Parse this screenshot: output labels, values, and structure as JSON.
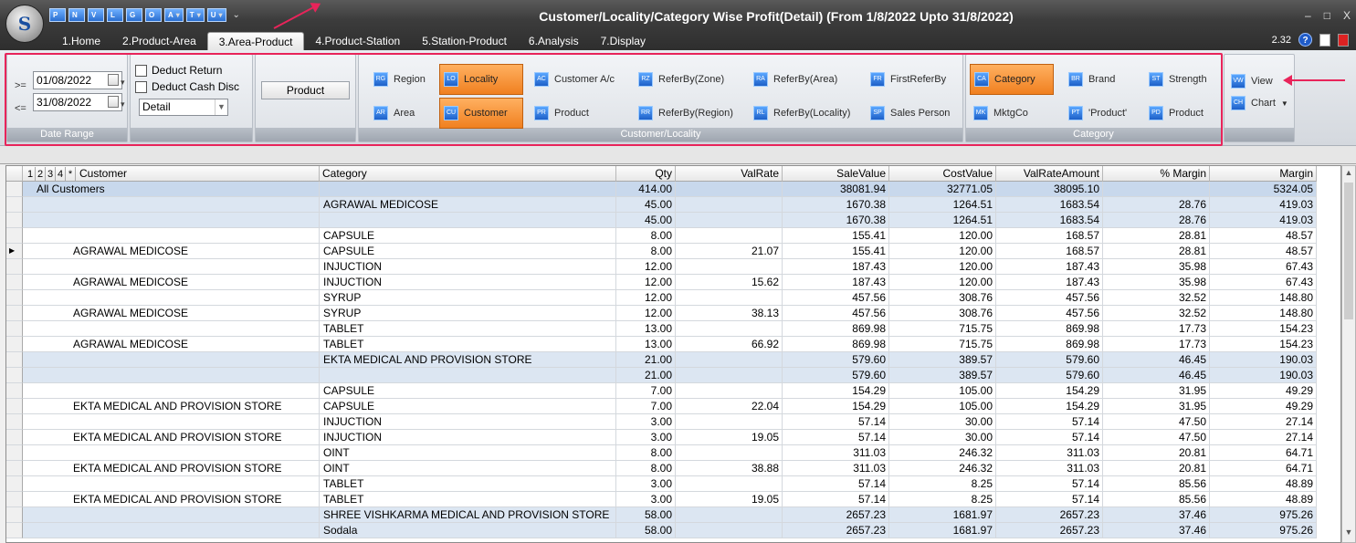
{
  "window": {
    "title": "Customer/Locality/Category Wise Profit(Detail) (From 1/8/2022 Upto 31/8/2022)",
    "logo_letter": "S",
    "controls": [
      "–",
      "□",
      "X"
    ],
    "quick_access": [
      "P",
      "N",
      "V",
      "L",
      "G",
      "O",
      "A",
      "T",
      "U"
    ],
    "version": "2.32",
    "help": "?"
  },
  "menu": {
    "tabs": [
      "1.Home",
      "2.Product-Area",
      "3.Area-Product",
      "4.Product-Station",
      "5.Station-Product",
      "6.Analysis",
      "7.Display"
    ],
    "active": "3.Area-Product"
  },
  "ribbon": {
    "date_range": {
      "from_label": ">=",
      "from_value": "01/08/2022",
      "to_label": "<=",
      "to_value": "31/08/2022",
      "caption": "Date Range"
    },
    "options": {
      "deduct_return": "Deduct Return",
      "deduct_cash_disc": "Deduct Cash Disc",
      "mode": "Detail"
    },
    "product_button": "Product",
    "customer_locality": {
      "caption": "Customer/Locality",
      "row1": [
        "Region",
        "Locality",
        "Customer A/c",
        "ReferBy(Zone)",
        "ReferBy(Area)",
        "FirstReferBy"
      ],
      "row2": [
        "Area",
        "Customer",
        "Product",
        "ReferBy(Region)",
        "ReferBy(Locality)",
        "Sales Person"
      ],
      "icons_row1": [
        "RG",
        "LO",
        "AC",
        "RZ",
        "RA",
        "FR"
      ],
      "icons_row2": [
        "AR",
        "CU",
        "PR",
        "RR",
        "RL",
        "SP"
      ]
    },
    "category": {
      "caption": "Category",
      "row1": [
        "Category",
        "Brand",
        "Strength"
      ],
      "row2": [
        "MktgCo",
        "'Product'",
        "Product"
      ],
      "icons_row1": [
        "CA",
        "BR",
        "ST"
      ],
      "icons_row2": [
        "MK",
        "PT",
        "PD"
      ]
    },
    "view": {
      "view_label": "View",
      "chart_label": "Chart",
      "view_icon": "VW",
      "chart_icon": "CH"
    }
  },
  "grid": {
    "levels": [
      "1",
      "2",
      "3",
      "4",
      "*"
    ],
    "columns": [
      "Customer",
      "Category",
      "Qty",
      "ValRate",
      "SaleValue",
      "CostValue",
      "ValRateAmount",
      "% Margin",
      "Margin"
    ],
    "rows": [
      {
        "type": "all",
        "customer": "All Customers",
        "category": "",
        "qty": "414.00",
        "valrate": "",
        "sale": "38081.94",
        "cost": "32771.05",
        "vra": "38095.10",
        "pm": "",
        "margin": "5324.05"
      },
      {
        "type": "band",
        "customer": "",
        "category": "AGRAWAL MEDICOSE",
        "qty": "45.00",
        "valrate": "",
        "sale": "1670.38",
        "cost": "1264.51",
        "vra": "1683.54",
        "pm": "28.76",
        "margin": "419.03"
      },
      {
        "type": "band",
        "customer": "",
        "category": "",
        "qty": "45.00",
        "valrate": "",
        "sale": "1670.38",
        "cost": "1264.51",
        "vra": "1683.54",
        "pm": "28.76",
        "margin": "419.03"
      },
      {
        "type": "",
        "customer": "",
        "category": "CAPSULE",
        "qty": "8.00",
        "valrate": "",
        "sale": "155.41",
        "cost": "120.00",
        "vra": "168.57",
        "pm": "28.81",
        "margin": "48.57"
      },
      {
        "type": "",
        "customer": "AGRAWAL MEDICOSE",
        "category": "CAPSULE",
        "qty": "8.00",
        "valrate": "21.07",
        "sale": "155.41",
        "cost": "120.00",
        "vra": "168.57",
        "pm": "28.81",
        "margin": "48.57",
        "current": true
      },
      {
        "type": "",
        "customer": "",
        "category": "INJUCTION",
        "qty": "12.00",
        "valrate": "",
        "sale": "187.43",
        "cost": "120.00",
        "vra": "187.43",
        "pm": "35.98",
        "margin": "67.43"
      },
      {
        "type": "",
        "customer": "AGRAWAL MEDICOSE",
        "category": "INJUCTION",
        "qty": "12.00",
        "valrate": "15.62",
        "sale": "187.43",
        "cost": "120.00",
        "vra": "187.43",
        "pm": "35.98",
        "margin": "67.43"
      },
      {
        "type": "",
        "customer": "",
        "category": "SYRUP",
        "qty": "12.00",
        "valrate": "",
        "sale": "457.56",
        "cost": "308.76",
        "vra": "457.56",
        "pm": "32.52",
        "margin": "148.80"
      },
      {
        "type": "",
        "customer": "AGRAWAL MEDICOSE",
        "category": "SYRUP",
        "qty": "12.00",
        "valrate": "38.13",
        "sale": "457.56",
        "cost": "308.76",
        "vra": "457.56",
        "pm": "32.52",
        "margin": "148.80"
      },
      {
        "type": "",
        "customer": "",
        "category": "TABLET",
        "qty": "13.00",
        "valrate": "",
        "sale": "869.98",
        "cost": "715.75",
        "vra": "869.98",
        "pm": "17.73",
        "margin": "154.23"
      },
      {
        "type": "",
        "customer": "AGRAWAL MEDICOSE",
        "category": "TABLET",
        "qty": "13.00",
        "valrate": "66.92",
        "sale": "869.98",
        "cost": "715.75",
        "vra": "869.98",
        "pm": "17.73",
        "margin": "154.23"
      },
      {
        "type": "band",
        "customer": "",
        "category": "EKTA MEDICAL AND PROVISION STORE",
        "qty": "21.00",
        "valrate": "",
        "sale": "579.60",
        "cost": "389.57",
        "vra": "579.60",
        "pm": "46.45",
        "margin": "190.03"
      },
      {
        "type": "band",
        "customer": "",
        "category": "",
        "qty": "21.00",
        "valrate": "",
        "sale": "579.60",
        "cost": "389.57",
        "vra": "579.60",
        "pm": "46.45",
        "margin": "190.03"
      },
      {
        "type": "",
        "customer": "",
        "category": "CAPSULE",
        "qty": "7.00",
        "valrate": "",
        "sale": "154.29",
        "cost": "105.00",
        "vra": "154.29",
        "pm": "31.95",
        "margin": "49.29"
      },
      {
        "type": "",
        "customer": "EKTA MEDICAL AND PROVISION STORE",
        "category": "CAPSULE",
        "qty": "7.00",
        "valrate": "22.04",
        "sale": "154.29",
        "cost": "105.00",
        "vra": "154.29",
        "pm": "31.95",
        "margin": "49.29"
      },
      {
        "type": "",
        "customer": "",
        "category": "INJUCTION",
        "qty": "3.00",
        "valrate": "",
        "sale": "57.14",
        "cost": "30.00",
        "vra": "57.14",
        "pm": "47.50",
        "margin": "27.14"
      },
      {
        "type": "",
        "customer": "EKTA MEDICAL AND PROVISION STORE",
        "category": "INJUCTION",
        "qty": "3.00",
        "valrate": "19.05",
        "sale": "57.14",
        "cost": "30.00",
        "vra": "57.14",
        "pm": "47.50",
        "margin": "27.14"
      },
      {
        "type": "",
        "customer": "",
        "category": "OINT",
        "qty": "8.00",
        "valrate": "",
        "sale": "311.03",
        "cost": "246.32",
        "vra": "311.03",
        "pm": "20.81",
        "margin": "64.71"
      },
      {
        "type": "",
        "customer": "EKTA MEDICAL AND PROVISION STORE",
        "category": "OINT",
        "qty": "8.00",
        "valrate": "38.88",
        "sale": "311.03",
        "cost": "246.32",
        "vra": "311.03",
        "pm": "20.81",
        "margin": "64.71"
      },
      {
        "type": "",
        "customer": "",
        "category": "TABLET",
        "qty": "3.00",
        "valrate": "",
        "sale": "57.14",
        "cost": "8.25",
        "vra": "57.14",
        "pm": "85.56",
        "margin": "48.89"
      },
      {
        "type": "",
        "customer": "EKTA MEDICAL AND PROVISION STORE",
        "category": "TABLET",
        "qty": "3.00",
        "valrate": "19.05",
        "sale": "57.14",
        "cost": "8.25",
        "vra": "57.14",
        "pm": "85.56",
        "margin": "48.89"
      },
      {
        "type": "band",
        "customer": "",
        "category": "SHREE VISHKARMA MEDICAL AND PROVISION STORE",
        "qty": "58.00",
        "valrate": "",
        "sale": "2657.23",
        "cost": "1681.97",
        "vra": "2657.23",
        "pm": "37.46",
        "margin": "975.26"
      },
      {
        "type": "band",
        "customer": "",
        "category": "Sodala",
        "qty": "58.00",
        "valrate": "",
        "sale": "2657.23",
        "cost": "1681.97",
        "vra": "2657.23",
        "pm": "37.46",
        "margin": "975.26"
      }
    ]
  },
  "colors": {
    "accent_orange": "#f08020",
    "highlight_red": "#e8245a",
    "band": "#dce6f2"
  }
}
